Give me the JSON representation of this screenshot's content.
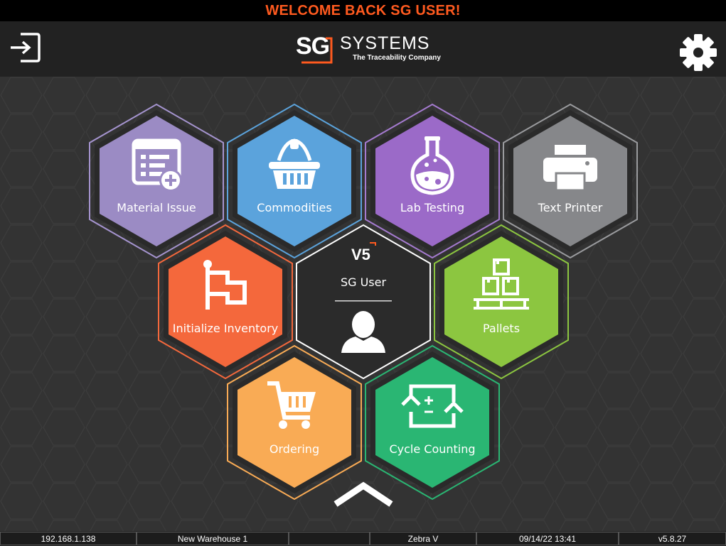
{
  "banner": {
    "text": "WELCOME BACK SG USER!"
  },
  "header": {
    "logo": {
      "mark": "SG",
      "name": "SYSTEMS",
      "tagline": "The Traceability Company"
    },
    "logout_icon": "logout-icon",
    "settings_icon": "gear-icon"
  },
  "center": {
    "version_badge": "V5",
    "user_name": "SG User",
    "avatar_icon": "user-avatar-icon"
  },
  "tiles": [
    {
      "label": "Material Issue",
      "icon": "form-add-icon",
      "color": "#9b8bc4",
      "border": "#a594cf"
    },
    {
      "label": "Commodities",
      "icon": "basket-icon",
      "color": "#5ba3dc",
      "border": "#5ba3dc"
    },
    {
      "label": "Lab Testing",
      "icon": "flask-icon",
      "color": "#9b6ac8",
      "border": "#a57bd0"
    },
    {
      "label": "Text Printer",
      "icon": "printer-icon",
      "color": "#86878a",
      "border": "#9a9b9e"
    },
    {
      "label": "Initialize Inventory",
      "icon": "flag-icon",
      "color": "#f4683c",
      "border": "#f4683c"
    },
    {
      "label": "Pallets",
      "icon": "pallet-icon",
      "color": "#8cc640",
      "border": "#8cc640"
    },
    {
      "label": "Ordering",
      "icon": "cart-icon",
      "color": "#f9ab55",
      "border": "#f9ab55"
    },
    {
      "label": "Cycle Counting",
      "icon": "cycle-count-icon",
      "color": "#2ab673",
      "border": "#2ab673"
    }
  ],
  "status_bar": {
    "ip": "192.168.1.138",
    "warehouse": "New Warehouse 1",
    "blank": "",
    "printer": "Zebra V",
    "datetime": "09/14/22 13:41",
    "version": "v5.8.27"
  },
  "colors": {
    "accent": "#ff5a1f",
    "background": "#333333",
    "header": "#222222"
  }
}
